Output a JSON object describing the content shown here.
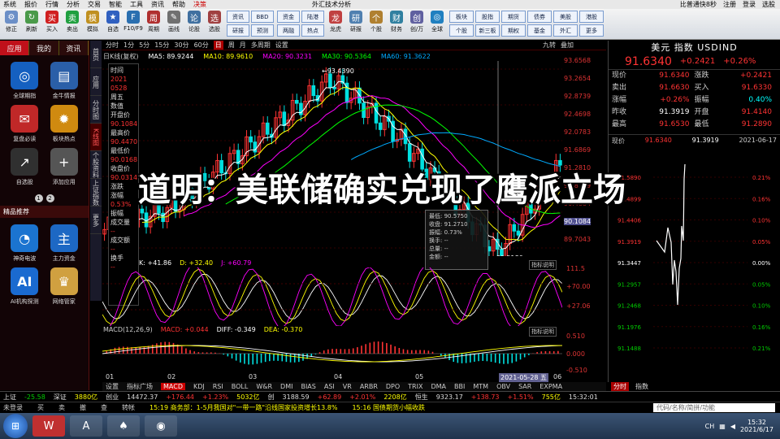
{
  "menubar": {
    "items": [
      "系统",
      "报价",
      "行情",
      "分析",
      "交易",
      "智能",
      "工具",
      "资讯",
      "帮助",
      "决策"
    ],
    "app_title": "外汇技术分析",
    "right": [
      "比普通快8秒",
      "注册",
      "登录",
      "选股"
    ]
  },
  "toolbar": {
    "buttons": [
      "修正",
      "刷新",
      "买入",
      "卖出",
      "模拟",
      "自选",
      "F10/F9",
      "周期",
      "画线",
      "论股",
      "选股"
    ],
    "text_buttons": [
      "资讯",
      "BBD",
      "陆港",
      "研报",
      "预测",
      "资金",
      "两融",
      "热点",
      "龙虎",
      "研报",
      "个股",
      "财务",
      "创/万",
      "全球"
    ],
    "right_buttons": [
      "板块",
      "股指",
      "期货",
      "债券",
      "美股",
      "港股",
      "个股",
      "新三板",
      "期权",
      "基金",
      "外汇",
      "更多"
    ]
  },
  "left_panel": {
    "tabs": [
      "应用",
      "我的",
      "资讯"
    ],
    "apps": [
      {
        "label": "全球期指",
        "icon": "globe-icon"
      },
      {
        "label": "金牛情报",
        "icon": "document-icon"
      },
      {
        "label": "复盘必读",
        "icon": "news-icon"
      },
      {
        "label": "板块热点",
        "icon": "hotspot-icon"
      },
      {
        "label": "自选股",
        "icon": "chart-icon"
      },
      {
        "label": "添加应用",
        "icon": "plus-icon"
      }
    ],
    "pages": [
      "1",
      "2"
    ],
    "section": "精品推荐",
    "recommended": [
      {
        "label": "神奇电波",
        "icon": "wave-icon"
      },
      {
        "label": "主力资金",
        "icon": "fund-icon"
      },
      {
        "label": "AI机构探测",
        "icon": "ai-icon"
      },
      {
        "label": "网络管家",
        "icon": "lion-icon"
      }
    ]
  },
  "vtabs": [
    "首页",
    "应用",
    "分时图",
    "K线图",
    "个股资料",
    "上证指数",
    "更多"
  ],
  "period": [
    "分时",
    "1分",
    "5分",
    "15分",
    "30分",
    "60分",
    "日",
    "周",
    "月",
    "多周期",
    "设置"
  ],
  "period_right": [
    "九转",
    "叠加"
  ],
  "ma": {
    "label": "日K线(复权)",
    "ma5": "MA5: 89.9244",
    "ma10": "MA10: 89.9610",
    "ma20": "MA20: 90.3231",
    "ma30": "MA30: 90.5364",
    "ma60": "MA60: 91.3622"
  },
  "infobox": [
    "时间",
    "2021",
    "0528",
    "周五",
    "数值",
    "开盘价",
    "90.1084",
    "最高价",
    "90.4470",
    "最低价",
    "90.0168",
    "收盘价",
    "90.0314",
    "涨跌",
    "涨幅",
    "0.53%",
    "振幅",
    "成交量",
    "--",
    "成交额",
    "--",
    "换手",
    "--"
  ],
  "price_axis": [
    "93.6568",
    "93.2654",
    "92.8739",
    "92.4698",
    "92.0783",
    "91.6869",
    "91.2810",
    "90.8799",
    "90.4884",
    "90.1084",
    "89.7043"
  ],
  "annotations": {
    "high": "93.4390",
    "low": "89.5180"
  },
  "tooltip": [
    "最低: 90.5750",
    "收盘: 91.2710",
    "振幅: 0.73%",
    "换手: --",
    "总量: --",
    "金额: --"
  ],
  "kdj": {
    "k": "K: +41.86",
    "d": "D: +32.40",
    "j": "J: +60.79",
    "axis": [
      "111.5",
      "+70.00",
      "+27.06"
    ]
  },
  "macd": {
    "title": "MACD(12,26,9)",
    "macd": "MACD: +0.044",
    "diff": "DIFF: -0.349",
    "dea": "DEA: -0.370",
    "axis": [
      "0.510",
      "0.000",
      "-0.510"
    ]
  },
  "zhibiao_label": "指标说明",
  "xaxis": [
    "01",
    "02",
    "03",
    "04",
    "05",
    "06"
  ],
  "xaxis_highlight": "2021-05-28 五",
  "indicator_tabs": [
    "设置",
    "指标广场",
    "MACD",
    "KDJ",
    "RSI",
    "BOLL",
    "W&R",
    "DMI",
    "BIAS",
    "ASI",
    "VR",
    "ARBR",
    "DPO",
    "TRIX",
    "DMA",
    "BBI",
    "MTM",
    "OBV",
    "SAR",
    "EXPMA"
  ],
  "quote": {
    "title": "美元 指数 USDIND",
    "price": "91.6340",
    "change": "+0.2421",
    "pct": "+0.26%",
    "rows": [
      [
        "现价",
        "91.6340",
        "涨跌",
        "+0.2421"
      ],
      [
        "卖出",
        "91.6630",
        "买入",
        "91.6330"
      ],
      [
        "涨幅",
        "+0.26%",
        "振幅",
        "0.40%"
      ],
      [
        "昨收",
        "91.3919",
        "开盘",
        "91.4140"
      ],
      [
        "最高",
        "91.6530",
        "最低",
        "91.2890"
      ]
    ],
    "tick_row": [
      "现价",
      "91.6340",
      "91.3919",
      "2021-06-17"
    ]
  },
  "mini_axis_left": [
    "91.5890",
    "91.4899",
    "91.4406",
    "91.3919",
    "91.3447",
    "91.2957",
    "91.2468",
    "91.1976",
    "91.1488"
  ],
  "mini_axis_right": [
    "0.21%",
    "0.16%",
    "0.10%",
    "0.05%",
    "0.00%",
    "0.05%",
    "0.10%",
    "0.16%",
    "0.21%"
  ],
  "rp_tabs": [
    "分时",
    "指数"
  ],
  "status": [
    "上证",
    "-25.58",
    "深证",
    "3880亿",
    "创业",
    "14472.37",
    "+176.44",
    "+1.23%",
    "5032亿",
    "创",
    "3188.59",
    "+62.89",
    "+2.01%",
    "2208亿",
    "恒生",
    "9323.17",
    "+138.73",
    "+1.51%",
    "755亿",
    "15:32:01"
  ],
  "ticker": [
    "未登录",
    "买",
    "卖",
    "撤",
    "查",
    "转帐",
    "15:19 商务部：1-5月我国对\"一带一路\"沿线国家投资增长13.8%",
    "15:16 国债期货小幅收跌"
  ],
  "quote_search": "代码/名称/简拼/功能",
  "clock": {
    "time": "15:32",
    "date": "2021/6/17"
  },
  "tray_lang": "CH",
  "headline": "道明：美联储确实兑现了鹰派立场",
  "colors": {
    "up": "#ff3333",
    "down": "#00e0e0",
    "accent": "#c00000",
    "ma5": "#ffffff",
    "ma10": "#ffff00",
    "ma20": "#ff00ff",
    "ma30": "#00ff00",
    "ma60": "#00aaff"
  }
}
